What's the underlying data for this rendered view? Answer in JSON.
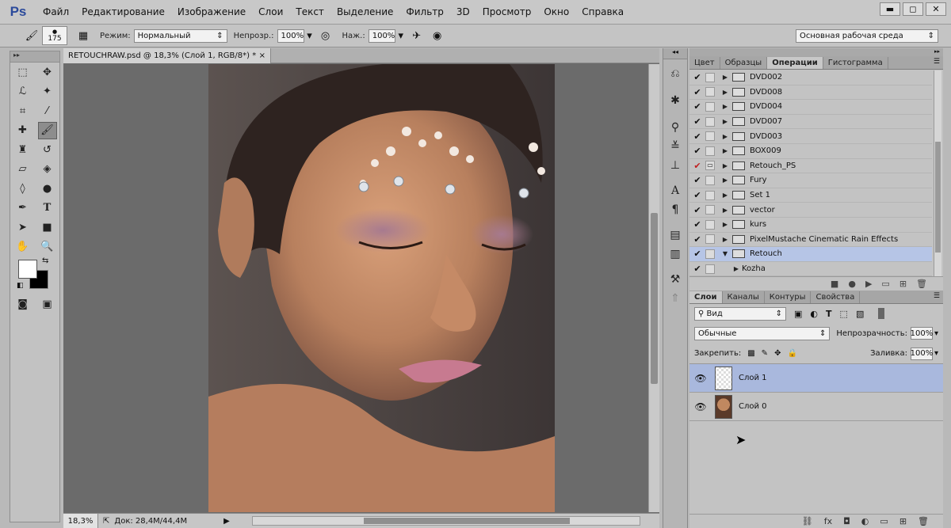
{
  "app": {
    "logo": "Ps"
  },
  "menu": [
    "Файл",
    "Редактирование",
    "Изображение",
    "Слои",
    "Текст",
    "Выделение",
    "Фильтр",
    "3D",
    "Просмотр",
    "Окно",
    "Справка"
  ],
  "window_controls": {
    "minimize": "▬",
    "restore": "◻",
    "close": "✕"
  },
  "options": {
    "brush_size": "175",
    "mode_label": "Режим:",
    "mode_value": "Нормальный",
    "opacity_label": "Непрозр.:",
    "opacity_value": "100%",
    "pressure_label": "Наж.:",
    "pressure_value": "100%",
    "workspace": "Основная рабочая среда"
  },
  "document": {
    "tab_title": "RETOUCHRAW.psd @ 18,3% (Слой 1, RGB/8*) *",
    "tab_close": "×",
    "zoom": "18,3%",
    "doc_info": "Док: 28,4M/44,4M"
  },
  "panels": {
    "top_tabs": [
      "Цвет",
      "Образцы",
      "Операции",
      "Гистограмма"
    ],
    "active_top_tab": "Операции",
    "actions": [
      {
        "name": "DVD002",
        "check": "✔",
        "open": false,
        "red": false
      },
      {
        "name": "DVD008",
        "check": "✔",
        "open": false,
        "red": false
      },
      {
        "name": "DVD004",
        "check": "✔",
        "open": false,
        "red": false
      },
      {
        "name": "DVD007",
        "check": "✔",
        "open": false,
        "red": false
      },
      {
        "name": "DVD003",
        "check": "✔",
        "open": false,
        "red": false
      },
      {
        "name": "BOX009",
        "check": "✔",
        "open": false,
        "red": false
      },
      {
        "name": "Retouch_PS",
        "check": "✔",
        "open": false,
        "red": true
      },
      {
        "name": "Fury",
        "check": "✔",
        "open": false,
        "red": false
      },
      {
        "name": "Set 1",
        "check": "✔",
        "open": false,
        "red": false
      },
      {
        "name": "vector",
        "check": "✔",
        "open": false,
        "red": false
      },
      {
        "name": "kurs",
        "check": "✔",
        "open": false,
        "red": false
      },
      {
        "name": "PixelMustache Cinematic Rain Effects",
        "check": "✔",
        "open": false,
        "red": false
      },
      {
        "name": "Retouch",
        "check": "✔",
        "open": true,
        "red": false,
        "selected": true
      }
    ],
    "sub_action": "Kozha",
    "layer_tabs": [
      "Слои",
      "Каналы",
      "Контуры",
      "Свойства"
    ],
    "active_layer_tab": "Слои",
    "filter_kind": "Вид",
    "blend_mode": "Обычные",
    "opacity_label": "Непрозрачность:",
    "opacity_value": "100%",
    "lock_label": "Закрепить:",
    "fill_label": "Заливка:",
    "fill_value": "100%",
    "layers": [
      {
        "name": "Слой 1",
        "selected": true
      },
      {
        "name": "Слой 0",
        "selected": false
      }
    ]
  },
  "colors": {
    "accent": "#b6c5e6",
    "panel": "#c3c3c3"
  }
}
